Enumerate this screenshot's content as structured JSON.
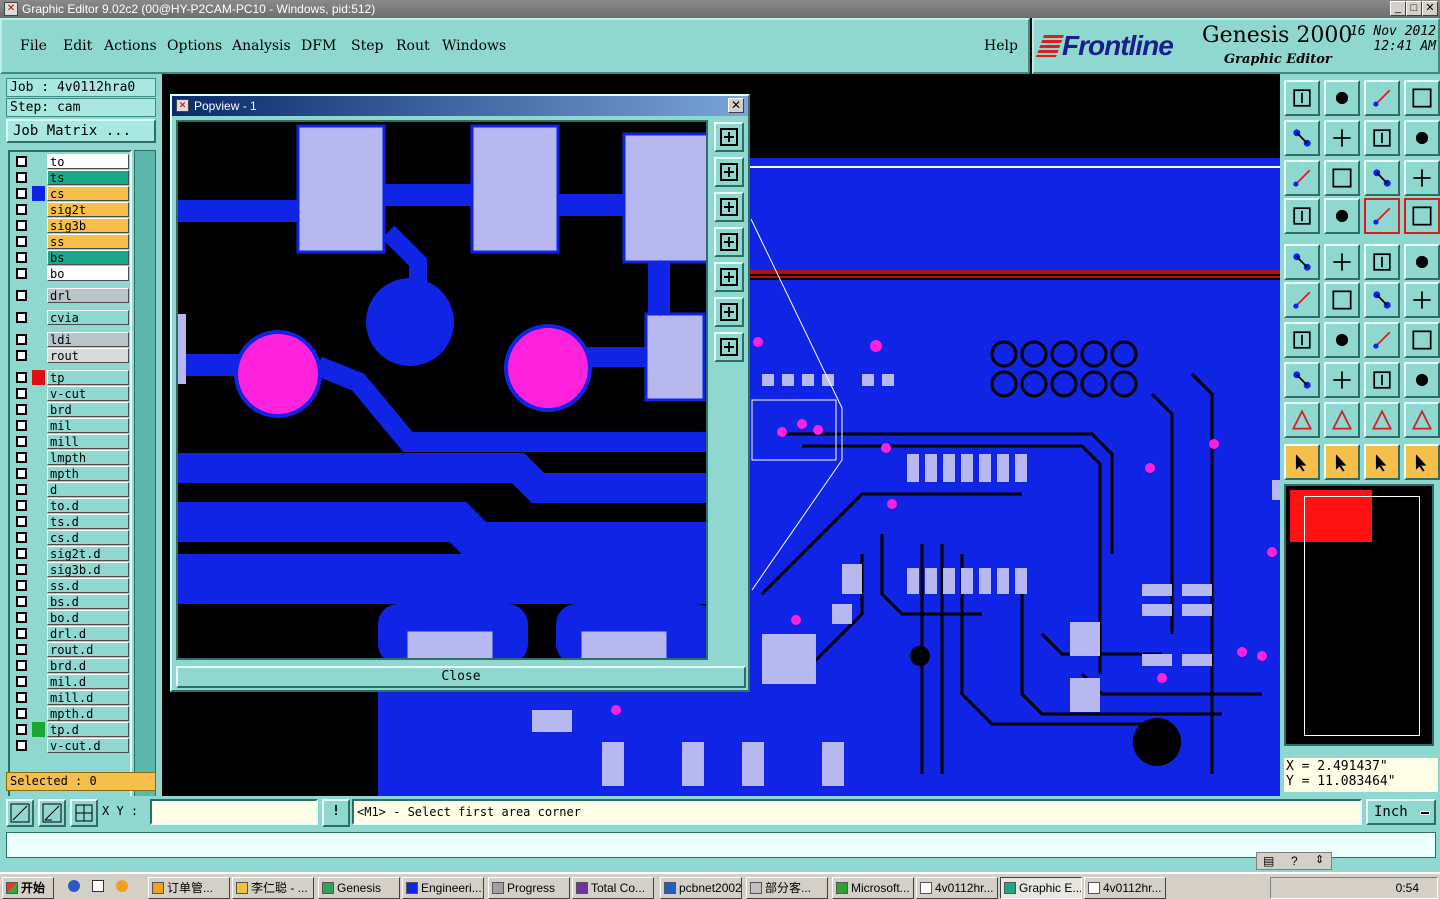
{
  "window": {
    "title": "Graphic Editor 9.02c2 (00@HY-P2CAM-PC10 - Windows, pid:512)",
    "min": "_",
    "max": "□",
    "close": "✕"
  },
  "menu": {
    "items": [
      "File",
      "Edit",
      "Actions",
      "Options",
      "Analysis",
      "DFM",
      "Step",
      "Rout",
      "Windows"
    ],
    "help": "Help"
  },
  "brand": {
    "logo": "Frontline",
    "product": "Genesis 2000",
    "subtitle": "Graphic Editor",
    "date": "16 Nov 2012",
    "time": "12:41 AM"
  },
  "job": {
    "job": "Job : 4v0112hra0",
    "step": "Step: cam",
    "matrix_button": "Job Matrix ...",
    "selected": "Selected : 0"
  },
  "layers": [
    {
      "name": "to",
      "color": "#ffffff",
      "swatch": ""
    },
    {
      "name": "ts",
      "color": "#1aa889",
      "swatch": ""
    },
    {
      "name": "cs",
      "color": "#f5c04a",
      "swatch": "#1024e6"
    },
    {
      "name": "sig2t",
      "color": "#f5c04a",
      "swatch": ""
    },
    {
      "name": "sig3b",
      "color": "#f5c04a",
      "swatch": ""
    },
    {
      "name": "ss",
      "color": "#f5c04a",
      "swatch": ""
    },
    {
      "name": "bs",
      "color": "#1aa889",
      "swatch": ""
    },
    {
      "name": "bo",
      "color": "#ffffff",
      "swatch": ""
    },
    {
      "name": "drl",
      "color": "#b9c4c8",
      "swatch": ""
    },
    {
      "name": "cvia",
      "color": "#8fd8cf",
      "swatch": ""
    },
    {
      "name": "ldi",
      "color": "#b9c4c8",
      "swatch": ""
    },
    {
      "name": "rout",
      "color": "#d6dcdc",
      "swatch": ""
    },
    {
      "name": "tp",
      "color": "#8fd8cf",
      "swatch": "#e01010"
    },
    {
      "name": "v-cut",
      "color": "#8fd8cf",
      "swatch": ""
    },
    {
      "name": "brd",
      "color": "#8fd8cf",
      "swatch": ""
    },
    {
      "name": "mil",
      "color": "#8fd8cf",
      "swatch": ""
    },
    {
      "name": "mill",
      "color": "#8fd8cf",
      "swatch": ""
    },
    {
      "name": "lmpth",
      "color": "#8fd8cf",
      "swatch": ""
    },
    {
      "name": "mpth",
      "color": "#8fd8cf",
      "swatch": ""
    },
    {
      "name": "d",
      "color": "#8fd8cf",
      "swatch": ""
    },
    {
      "name": "to.d",
      "color": "#8fd8cf",
      "swatch": ""
    },
    {
      "name": "ts.d",
      "color": "#8fd8cf",
      "swatch": ""
    },
    {
      "name": "cs.d",
      "color": "#8fd8cf",
      "swatch": ""
    },
    {
      "name": "sig2t.d",
      "color": "#8fd8cf",
      "swatch": ""
    },
    {
      "name": "sig3b.d",
      "color": "#8fd8cf",
      "swatch": ""
    },
    {
      "name": "ss.d",
      "color": "#8fd8cf",
      "swatch": ""
    },
    {
      "name": "bs.d",
      "color": "#8fd8cf",
      "swatch": ""
    },
    {
      "name": "bo.d",
      "color": "#8fd8cf",
      "swatch": ""
    },
    {
      "name": "drl.d",
      "color": "#8fd8cf",
      "swatch": ""
    },
    {
      "name": "rout.d",
      "color": "#8fd8cf",
      "swatch": ""
    },
    {
      "name": "brd.d",
      "color": "#8fd8cf",
      "swatch": ""
    },
    {
      "name": "mil.d",
      "color": "#8fd8cf",
      "swatch": ""
    },
    {
      "name": "mill.d",
      "color": "#8fd8cf",
      "swatch": ""
    },
    {
      "name": "mpth.d",
      "color": "#8fd8cf",
      "swatch": ""
    },
    {
      "name": "tp.d",
      "color": "#8fd8cf",
      "swatch": "#1aa830"
    },
    {
      "name": "v-cut.d",
      "color": "#8fd8cf",
      "swatch": ""
    }
  ],
  "popview": {
    "title": "Popview - 1",
    "close_label": "Close"
  },
  "coords": {
    "x": "X = 2.491437\"",
    "y": "Y = 11.083464\""
  },
  "status": {
    "xy_label": "X Y :",
    "prompt": "<M1> - Select first area corner",
    "unit": "Inch",
    "info_glyph": "!"
  },
  "taskbar": {
    "start": "开始",
    "tasks": [
      "订单管...",
      "李仁聪 - ...",
      "Genesis",
      "Engineeri...",
      "Progress",
      "Total Co...",
      "pcbnet2002",
      "部分客...",
      "Microsoft...",
      "4v0112hr...",
      "Graphic E...",
      "4v0112hr..."
    ],
    "clock": "0:54"
  },
  "colors": {
    "panel": "#8fd8cf",
    "copper": "#1024e6",
    "pad": "#b8b8f0",
    "via": "#ff22dd"
  }
}
